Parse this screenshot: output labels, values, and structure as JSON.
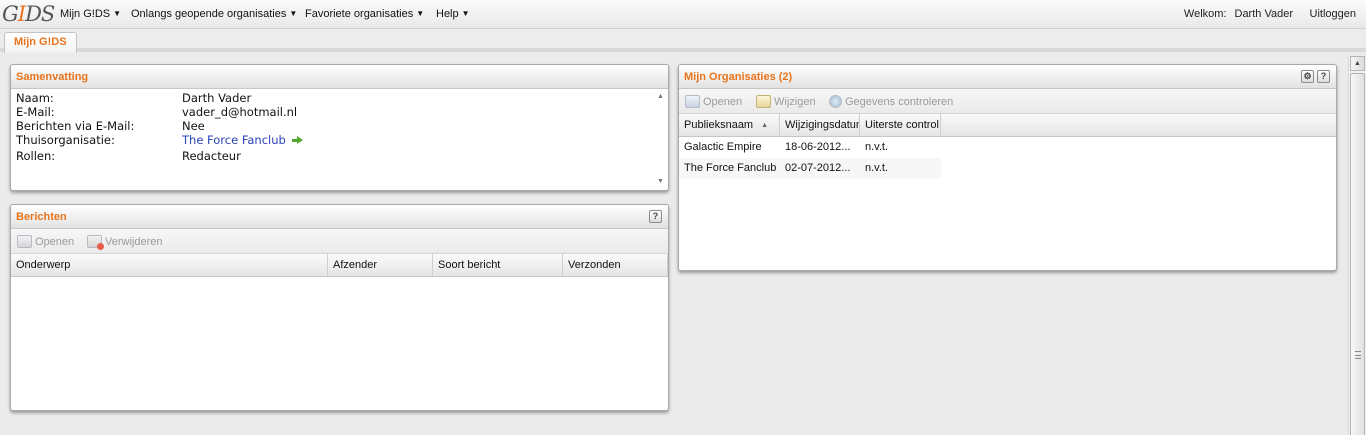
{
  "topbar": {
    "logo_text": "GIDS",
    "menus": [
      {
        "label": "Mijn G!DS"
      },
      {
        "label": "Onlangs geopende organisaties"
      },
      {
        "label": "Favoriete organisaties"
      },
      {
        "label": "Help"
      }
    ],
    "welcome_label": "Welkom:",
    "user_name": "Darth Vader",
    "logout_label": "Uitloggen"
  },
  "tabs": [
    {
      "label": "Mijn G!DS",
      "active": true
    }
  ],
  "summary": {
    "title": "Samenvatting",
    "rows": [
      {
        "label": "Naam:",
        "value": "Darth Vader"
      },
      {
        "label": "E-Mail:",
        "value": "vader_d@hotmail.nl"
      },
      {
        "label": "Berichten via E-Mail:",
        "value": "Nee"
      },
      {
        "label": "Thuisorganisatie:",
        "value": "The Force Fanclub"
      },
      {
        "label": "Rollen:",
        "value": "Redacteur"
      }
    ]
  },
  "messages": {
    "title": "Berichten",
    "help_icon": "?",
    "toolbar": {
      "open_label": "Openen",
      "delete_label": "Verwijderen"
    },
    "columns": [
      "Onderwerp",
      "Afzender",
      "Soort bericht",
      "Verzonden"
    ],
    "rows": []
  },
  "organisations": {
    "title": "Mijn Organisaties (2)",
    "help_icon": "?",
    "toolbar": {
      "open_label": "Openen",
      "edit_label": "Wijzigen",
      "check_label": "Gegevens controleren"
    },
    "columns": [
      "Publieksnaam",
      "Wijzigingsdatum",
      "Uiterste control"
    ],
    "rows": [
      {
        "name": "Galactic Empire",
        "date": "18-06-2012...",
        "deadline": "n.v.t."
      },
      {
        "name": "The Force Fanclub",
        "date": "02-07-2012...",
        "deadline": "n.v.t."
      }
    ]
  },
  "colors": {
    "accent": "#e8741d",
    "link": "#2a43b8"
  }
}
